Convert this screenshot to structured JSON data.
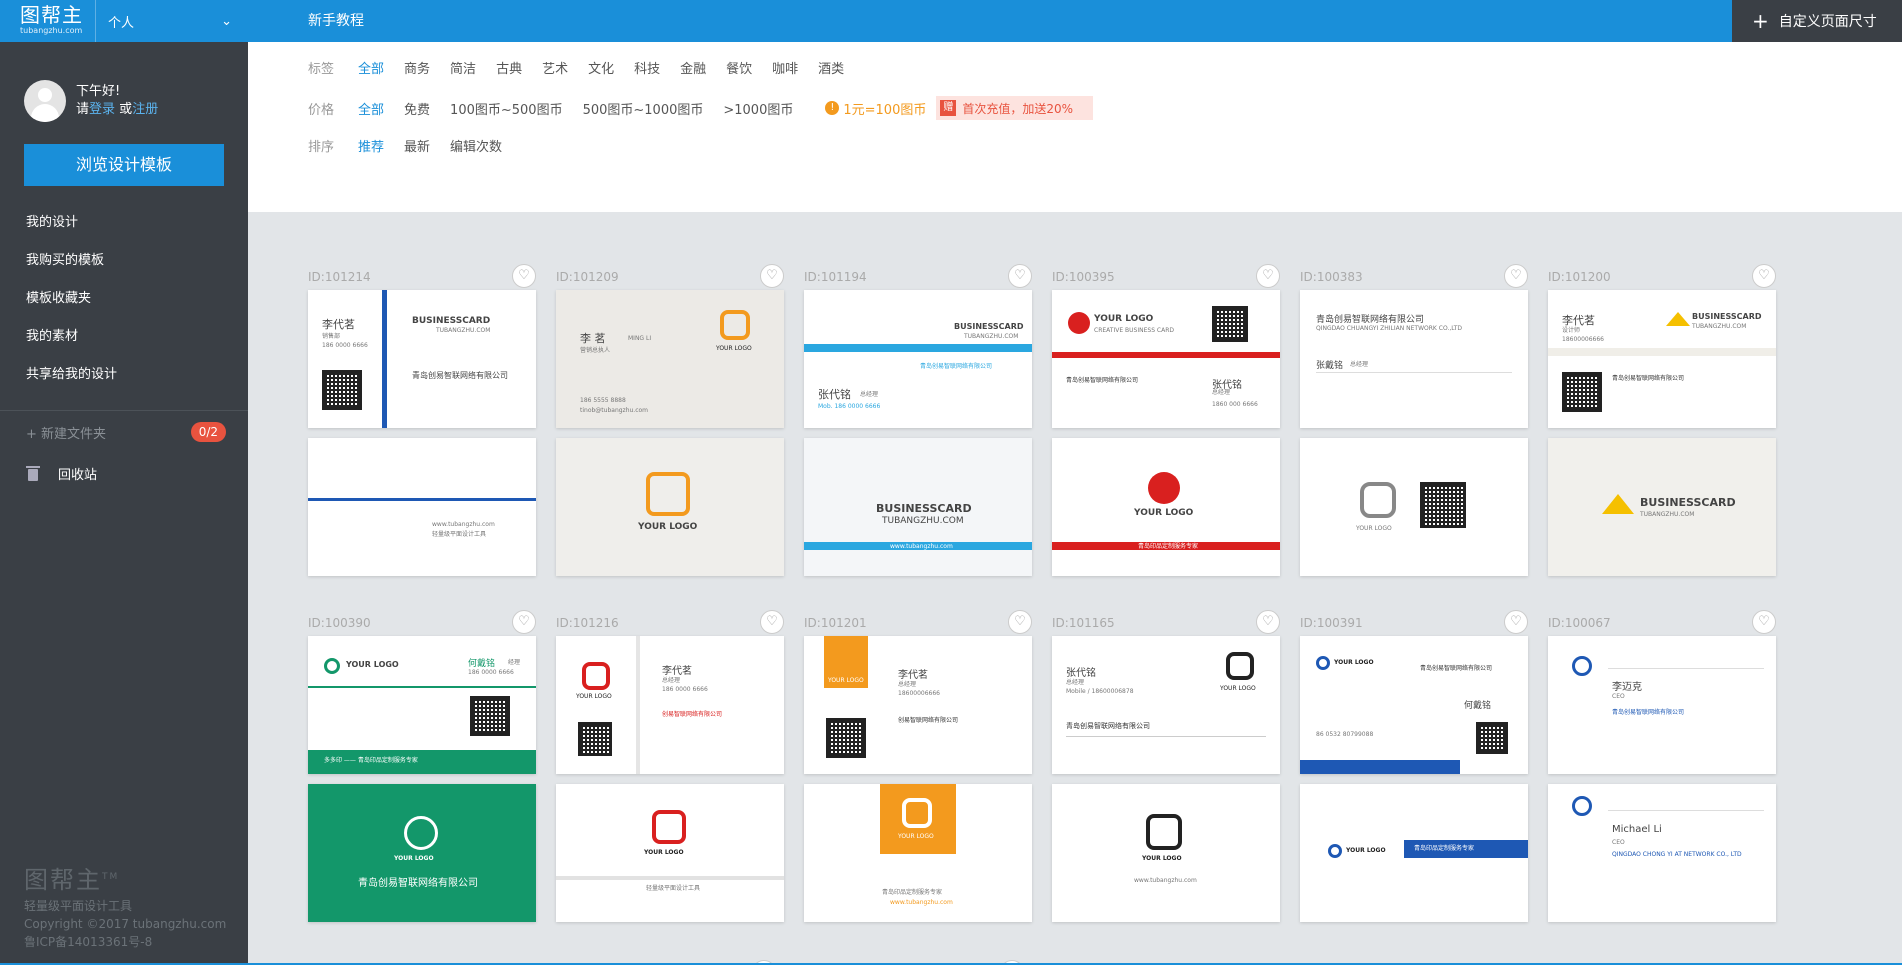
{
  "sidebar": {
    "logo": "图帮主",
    "logo_sub": "tubangzhu.com",
    "workspace": "个人",
    "greeting": "下午好!",
    "prompt_prefix": "请",
    "login_label": "登录",
    "or_label": "或",
    "register_label": "注册",
    "browse_button": "浏览设计模板",
    "nav": [
      "我的设计",
      "我购买的模板",
      "模板收藏夹",
      "我的素材",
      "共享给我的设计"
    ],
    "new_folder": "新建文件夹",
    "folder_quota": "0/2",
    "trash": "回收站",
    "footer_logo": "图帮主",
    "footer_tm": "TM",
    "footer_lines": [
      "轻量级平面设计工具",
      "Copyright ©2017 tubangzhu.com",
      "鲁ICP备14013361号-8"
    ]
  },
  "topbar": {
    "tutorial": "新手教程",
    "custom_size": "自定义页面尺寸",
    "plus_icon": "plus-icon"
  },
  "filters": {
    "tag_label": "标签",
    "tags": [
      "全部",
      "商务",
      "简洁",
      "古典",
      "艺术",
      "文化",
      "科技",
      "金融",
      "餐饮",
      "咖啡",
      "酒类"
    ],
    "price_label": "价格",
    "prices": [
      "全部",
      "免费",
      "100图币~500图币",
      "500图币~1000图币",
      ">1000图币"
    ],
    "coin_note": "1元=100图币",
    "promo_icon_label": "赠",
    "promo": "首次充值，加送20%",
    "sort_label": "排序",
    "sorts": [
      "推荐",
      "最新",
      "编辑次数"
    ],
    "active_color": "#1a8fd9"
  },
  "templates": [
    {
      "id": "ID:101214",
      "name": "李代茗",
      "title": "销售部",
      "phone": "186 0000 6666",
      "brand": "BUSINESSCARD",
      "site": "TUBANGZHU.COM",
      "company": "青岛创易智联网络有限公司",
      "back_text": "www.tubangzhu.com",
      "back_sub": "轻量级平面设计工具",
      "accent": "#1e58b4"
    },
    {
      "id": "ID:101209",
      "name": "李 茗",
      "name_en": "MING LI",
      "title": "营销总执人",
      "phone": "186 5555 8888",
      "email": "tinob@tubangzhu.com",
      "logo": "YOUR LOGO",
      "accent": "#f39a1e"
    },
    {
      "id": "ID:101194",
      "brand": "BUSINESSCARD",
      "site": "TUBANGZHU.COM",
      "company": "青岛创易智联网络有限公司",
      "name": "张代铭",
      "title": "总经理",
      "phone": "Mob. 186 0000 6666",
      "back_url": "www.tubangzhu.com",
      "accent": "#2aa7e0"
    },
    {
      "id": "ID:100395",
      "logo": "YOUR LOGO",
      "logo_sub": "CREATIVE BUSINESS CARD",
      "company": "青岛创易智联网络有限公司",
      "name": "张代铭",
      "title": "总经理",
      "phone": "1860 000 6666",
      "back_band": "青岛印品定制服务专家",
      "accent": "#d9201f"
    },
    {
      "id": "ID:100383",
      "company": "青岛创易智联网络有限公司",
      "company_en": "QINGDAO CHUANGYI ZHILIAN NETWORK CO.,LTD",
      "name": "张戴铭",
      "title": "总经理",
      "back_logo": "YOUR LOGO",
      "accent": "#888888"
    },
    {
      "id": "ID:101200",
      "name": "李代茗",
      "title": "设计师",
      "phone": "18600006666",
      "brand": "BUSINESSCARD",
      "site": "TUBANGZHU.COM",
      "company": "青岛创易智联网络有限公司",
      "accent": "#f5c000"
    },
    {
      "id": "ID:100390",
      "logo": "YOUR LOGO",
      "name": "何戴铭",
      "title": "经理",
      "phone": "186 0000 6666",
      "footer": "多多印 —— 青岛印品定制服务专家",
      "back_company": "青岛创易智联网络有限公司",
      "accent": "#13976a"
    },
    {
      "id": "ID:101216",
      "logo": "YOUR LOGO",
      "name": "李代茗",
      "title": "总经理",
      "phone": "186 0000 6666",
      "company": "创易智联网络有限公司",
      "back_sub": "轻量级平面设计工具",
      "accent": "#d9201f"
    },
    {
      "id": "ID:101201",
      "logo": "YOUR LOGO",
      "name": "李代茗",
      "title": "总经理",
      "phone": "18600006666",
      "company": "创易智联网络有限公司",
      "back_text": "青岛印品定制服务专家",
      "back_url": "www.tubangzhu.com",
      "accent": "#f39a1e"
    },
    {
      "id": "ID:101165",
      "name": "张代铭",
      "title": "总经理",
      "phone": "Mobile / 18600006878",
      "company": "青岛创易智联网络有限公司",
      "logo": "YOUR LOGO",
      "back_url": "www.tubangzhu.com",
      "accent": "#222222"
    },
    {
      "id": "ID:100391",
      "logo": "YOUR LOGO",
      "company": "青岛创易智联网络有限公司",
      "name": "何戴铭",
      "phone": "86 0532 80799088",
      "back_band": "青岛印品定制服务专家",
      "accent": "#1e58b4"
    },
    {
      "id": "ID:100067",
      "name": "李迈克",
      "title": "CEO",
      "company": "青岛创易智联网络有限公司",
      "name_en": "Michael Li",
      "company_en": "QINGDAO CHONG YI AT NETWORK CO., LTD",
      "accent": "#1e58b4"
    }
  ],
  "icons": {
    "heart": "heart-icon",
    "coin": "coin-icon",
    "trash": "trash-icon",
    "avatar": "user-avatar-icon",
    "chevron": "chevron-down-icon"
  }
}
